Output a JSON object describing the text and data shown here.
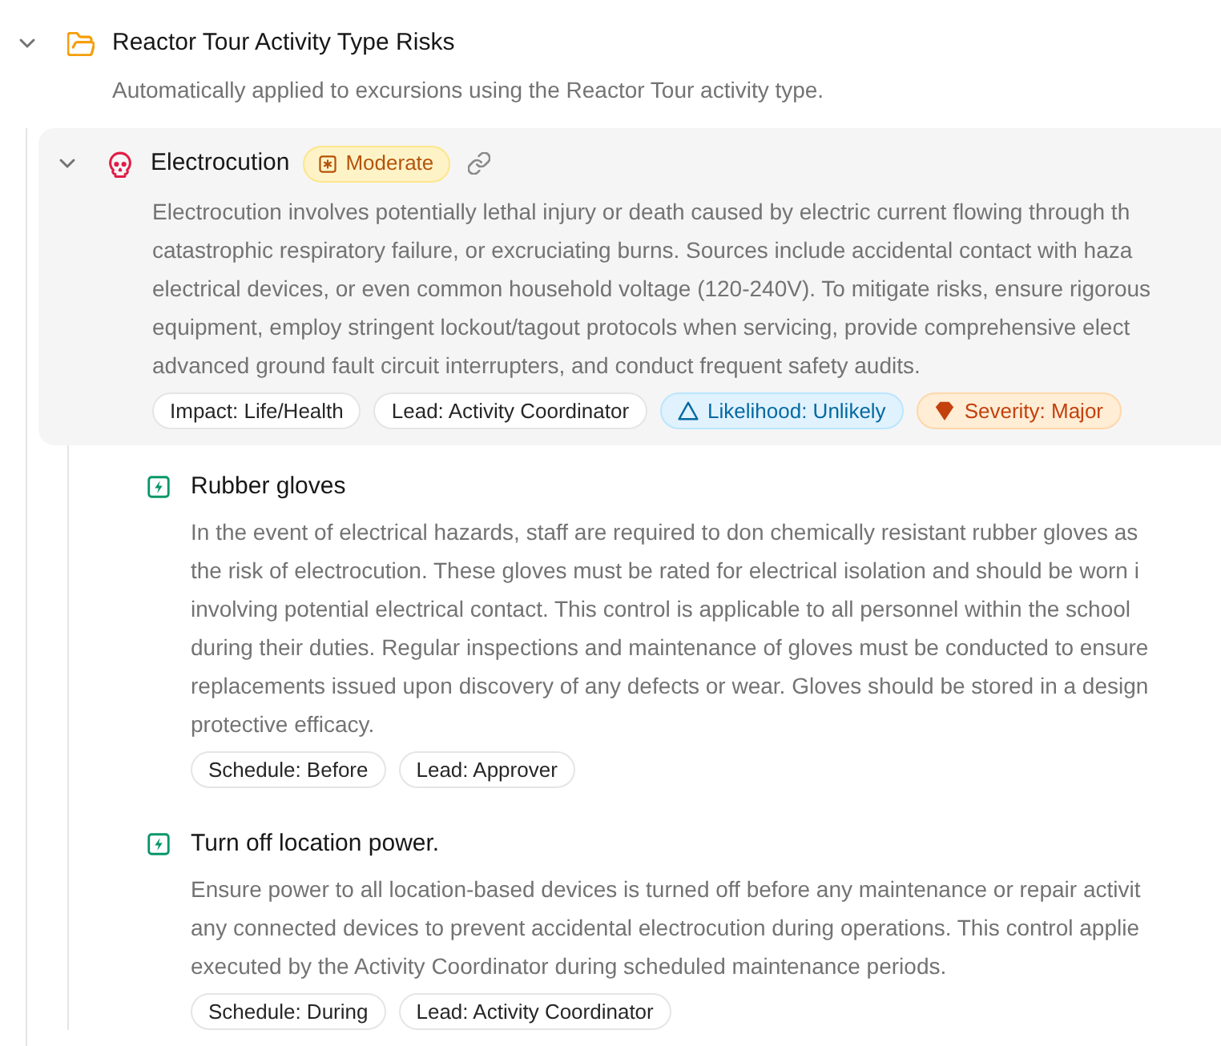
{
  "group": {
    "title": "Reactor Tour Activity Type Risks",
    "expanded": true,
    "subtitle": "Automatically applied to excursions using the Reactor Tour activity type.",
    "risks": [
      {
        "title": "Electrocution",
        "expanded": true,
        "rating": "Moderate",
        "description_lines": [
          "Electrocution involves potentially lethal injury or death caused by electric current flowing through th",
          "catastrophic respiratory failure, or excruciating burns. Sources include accidental contact with haza",
          "electrical devices, or even common household voltage (120-240V). To mitigate risks, ensure rigorous",
          "equipment, employ stringent lockout/tagout protocols when servicing, provide comprehensive elect",
          "advanced ground fault circuit interrupters, and conduct frequent safety audits."
        ],
        "tags": [
          {
            "kind": "plain",
            "label": "Impact: Life/Health"
          },
          {
            "kind": "plain",
            "label": "Lead: Activity Coordinator"
          },
          {
            "kind": "likelihood",
            "label": "Likelihood: Unlikely"
          },
          {
            "kind": "severity",
            "label": "Severity: Major"
          }
        ],
        "controls": [
          {
            "title": "Rubber gloves",
            "description_lines": [
              "In the event of electrical hazards, staff are required to don chemically resistant rubber gloves as",
              "the risk of electrocution. These gloves must be rated for electrical isolation and should be worn i",
              "involving potential electrical contact. This control is applicable to all personnel within the school",
              "during their duties. Regular inspections and maintenance of gloves must be conducted to ensure",
              "replacements issued upon discovery of any defects or wear. Gloves should be stored in a design",
              "protective efficacy."
            ],
            "tags": [
              {
                "kind": "plain",
                "label": "Schedule: Before"
              },
              {
                "kind": "plain",
                "label": "Lead: Approver"
              }
            ]
          },
          {
            "title": "Turn off location power.",
            "description_lines": [
              "Ensure power to all location-based devices is turned off before any maintenance or repair activit",
              "any connected devices to prevent accidental electrocution during operations. This control applie",
              "executed by the Activity Coordinator during scheduled maintenance periods."
            ],
            "tags": [
              {
                "kind": "plain",
                "label": "Schedule: During"
              },
              {
                "kind": "plain",
                "label": "Lead: Activity Coordinator"
              }
            ]
          }
        ]
      }
    ]
  }
}
